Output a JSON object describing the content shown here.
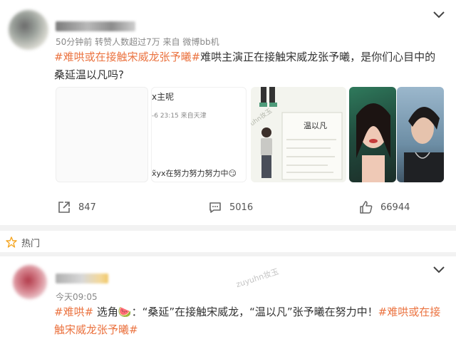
{
  "post1": {
    "meta": "50分钟前 转赞人数超过7万  来自 微博bb机",
    "hashtag": "#难哄或在接触宋威龙张予曦#",
    "body": "难哄主演正在接触宋威龙张予曦，是你们心目中的桑延温以凡吗?",
    "thumb2": {
      "line1": "x主呢",
      "line2": "-6 23:15  来自天津",
      "line3": "x̃yx在努力努力努力中😏"
    },
    "thumb3": {
      "card_title": "温以凡",
      "watermark": "zuyuhn妆玉"
    },
    "actions": {
      "repost": "847",
      "comment": "5016",
      "like": "66944"
    }
  },
  "hot_label": "热门",
  "post2": {
    "meta": "今天09:05",
    "tag_start": "#难哄#",
    "body_mid": " 选角🍉：“桑延”在接触宋威龙，“温以凡”张予曦在努力中！",
    "tag_end": "#难哄或在接触宋威龙张予曦#",
    "watermark": "zuyuhn妆玉"
  },
  "colors": {
    "accent": "#eb7340",
    "hot_icon": "#f5a623"
  }
}
